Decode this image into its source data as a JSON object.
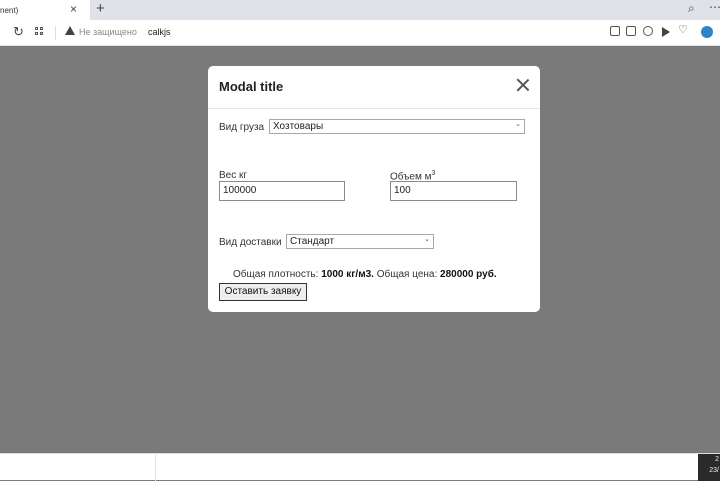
{
  "browser": {
    "tab_title": "nent)",
    "tab_close": "×",
    "new_tab": "+",
    "insecure_label": "Не защищено",
    "url": "calkjs"
  },
  "modal": {
    "title": "Modal title",
    "cargo_type_label": "Вид груза",
    "cargo_type_value": "Хозтовары",
    "weight_label": "Вес кг",
    "weight_value": "100000",
    "volume_label": "Объем м",
    "volume_unit_exp": "3",
    "volume_value": "100",
    "delivery_label": "Вид доставки",
    "delivery_value": "Стандарт",
    "density_label": "Общая плотность:",
    "density_value": "1000 кг/м3.",
    "price_label": "Общая цена:",
    "price_value": "280000 руб.",
    "submit_label": "Оставить заявку"
  },
  "taskbar": {
    "clock_line1": "2",
    "clock_line2": "23/"
  },
  "colors": {
    "backdrop": "#7a7a7a",
    "avatar": "#2f83c7"
  },
  "icons": [
    "close-icon",
    "reload-icon",
    "grid-icon",
    "warning-icon",
    "search-icon",
    "more-icon",
    "share-icon",
    "camera-icon",
    "shield-icon",
    "send-icon",
    "heart-icon",
    "user-icon"
  ]
}
